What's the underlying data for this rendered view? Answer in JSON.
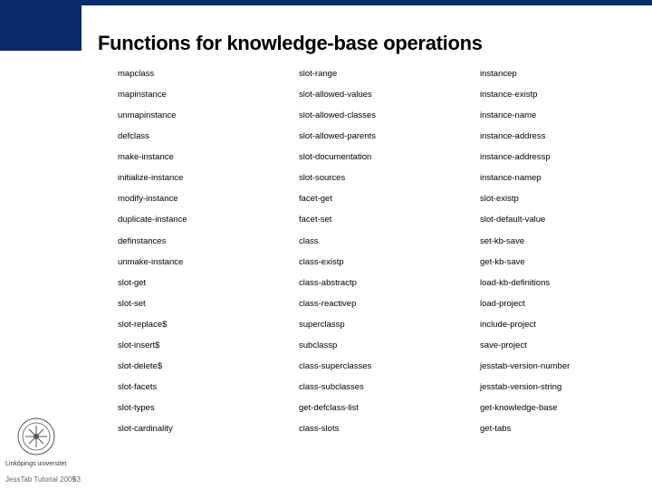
{
  "slide": {
    "title": "Functions for knowledge-base operations",
    "columns": [
      [
        "mapclass",
        "mapinstance",
        "unmapinstance",
        "defclass",
        "make-instance",
        "initialize-instance",
        "modify-instance",
        "duplicate-instance",
        "definstances",
        "unmake-instance",
        "slot-get",
        "slot-set",
        "slot-replace$",
        "slot-insert$",
        "slot-delete$",
        "slot-facets",
        "slot-types",
        "slot-cardinality"
      ],
      [
        "slot-range",
        "slot-allowed-values",
        "slot-allowed-classes",
        "slot-allowed-parents",
        "slot-documentation",
        "slot-sources",
        "facet-get",
        "facet-set",
        "class",
        "class-existp",
        "class-abstractp",
        "class-reactivep",
        "superclassp",
        "subclassp",
        "class-superclasses",
        "class-subclasses",
        "get-defclass-list",
        "class-slots"
      ],
      [
        "instancep",
        "instance-existp",
        "instance-name",
        "instance-address",
        "instance-addressp",
        "instance-namep",
        "slot-existp",
        "slot-default-value",
        "set-kb-save",
        "get-kb-save",
        "load-kb-definitions",
        "load-project",
        "include-project",
        "save-project",
        "jesstab-version-number",
        "jesstab-version-string",
        "get-knowledge-base",
        "get-tabs"
      ]
    ]
  },
  "branding": {
    "university": "Linköpings universitet"
  },
  "footer": {
    "label": "JessTab Tutorial 2009",
    "page": "53"
  }
}
